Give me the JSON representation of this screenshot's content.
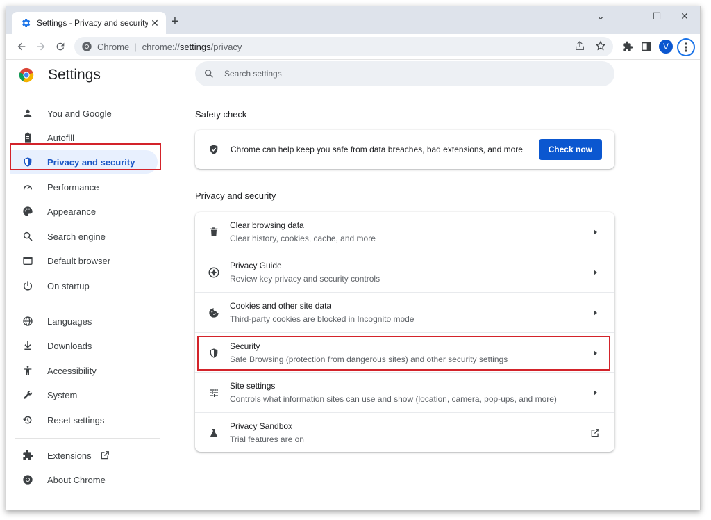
{
  "tab": {
    "title": "Settings - Privacy and security",
    "close": "✕"
  },
  "window_controls": {
    "minimize": "—",
    "maximize": "☐",
    "close": "✕",
    "tab_search": "⌄",
    "new_tab": "+"
  },
  "omnibox": {
    "site_name": "Chrome",
    "separator": "|",
    "url_prefix": "chrome://",
    "url_main": "settings",
    "url_suffix": "/privacy"
  },
  "profile": {
    "initial": "V"
  },
  "sidebar": {
    "title": "Settings",
    "items": [
      {
        "label": "You and Google",
        "icon": "person-icon"
      },
      {
        "label": "Autofill",
        "icon": "clipboard-icon"
      },
      {
        "label": "Privacy and security",
        "icon": "shield-icon",
        "active": true
      },
      {
        "label": "Performance",
        "icon": "speedometer-icon"
      },
      {
        "label": "Appearance",
        "icon": "palette-icon"
      },
      {
        "label": "Search engine",
        "icon": "search-icon"
      },
      {
        "label": "Default browser",
        "icon": "browser-icon"
      },
      {
        "label": "On startup",
        "icon": "power-icon"
      },
      {
        "label": "Languages",
        "icon": "globe-icon"
      },
      {
        "label": "Downloads",
        "icon": "download-icon"
      },
      {
        "label": "Accessibility",
        "icon": "accessibility-icon"
      },
      {
        "label": "System",
        "icon": "wrench-icon"
      },
      {
        "label": "Reset settings",
        "icon": "restore-icon"
      },
      {
        "label": "Extensions",
        "icon": "puzzle-icon"
      },
      {
        "label": "About Chrome",
        "icon": "chrome-icon"
      }
    ]
  },
  "search": {
    "placeholder": "Search settings"
  },
  "safety_check": {
    "heading": "Safety check",
    "message": "Chrome can help keep you safe from data breaches, bad extensions, and more",
    "button": "Check now"
  },
  "privacy": {
    "heading": "Privacy and security",
    "rows": [
      {
        "title": "Clear browsing data",
        "subtitle": "Clear history, cookies, cache, and more",
        "icon": "trash-icon"
      },
      {
        "title": "Privacy Guide",
        "subtitle": "Review key privacy and security controls",
        "icon": "compass-icon"
      },
      {
        "title": "Cookies and other site data",
        "subtitle": "Third-party cookies are blocked in Incognito mode",
        "icon": "cookie-icon"
      },
      {
        "title": "Security",
        "subtitle": "Safe Browsing (protection from dangerous sites) and other security settings",
        "icon": "shield-icon",
        "highlighted": true
      },
      {
        "title": "Site settings",
        "subtitle": "Controls what information sites can use and show (location, camera, pop-ups, and more)",
        "icon": "tune-icon"
      },
      {
        "title": "Privacy Sandbox",
        "subtitle": "Trial features are on",
        "icon": "flask-icon"
      }
    ]
  },
  "colors": {
    "accent": "#0b57d0",
    "highlight_box": "#d3232a",
    "active_nav_bg": "#e8f0fe"
  }
}
